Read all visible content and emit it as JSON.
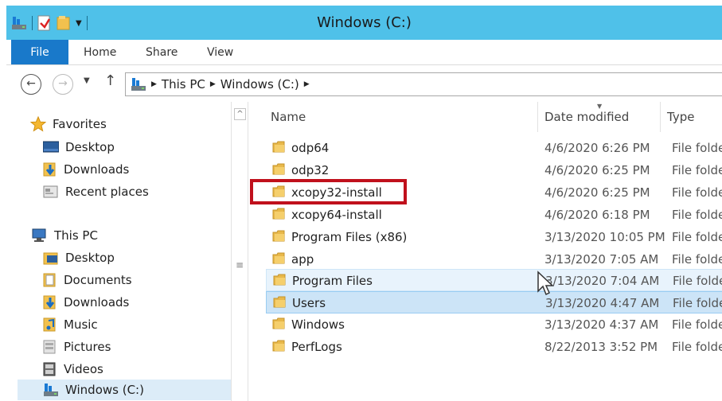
{
  "window": {
    "title": "Windows (C:)"
  },
  "ribbon": {
    "tabs": [
      "File",
      "Home",
      "Share",
      "View"
    ]
  },
  "address": {
    "crumbs": [
      "This PC",
      "Windows (C:)"
    ]
  },
  "nav": {
    "favorites_label": "Favorites",
    "favorites": [
      "Desktop",
      "Downloads",
      "Recent places"
    ],
    "thispc_label": "This PC",
    "thispc_items": [
      "Desktop",
      "Documents",
      "Downloads",
      "Music",
      "Pictures",
      "Videos",
      "Windows (C:)"
    ]
  },
  "columns": {
    "name": "Name",
    "date": "Date modified",
    "type": "Type"
  },
  "files": [
    {
      "name": "odp64",
      "date": "4/6/2020 6:26 PM",
      "type": "File folde"
    },
    {
      "name": "odp32",
      "date": "4/6/2020 6:25 PM",
      "type": "File folde"
    },
    {
      "name": "xcopy32-install",
      "date": "4/6/2020 6:25 PM",
      "type": "File folde"
    },
    {
      "name": "xcopy64-install",
      "date": "4/6/2020 6:18 PM",
      "type": "File folde"
    },
    {
      "name": "Program Files (x86)",
      "date": "3/13/2020 10:05 PM",
      "type": "File folde"
    },
    {
      "name": "app",
      "date": "3/13/2020 7:05 AM",
      "type": "File folde"
    },
    {
      "name": "Program Files",
      "date": "3/13/2020 7:04 AM",
      "type": "File folde"
    },
    {
      "name": "Users",
      "date": "3/13/2020 4:47 AM",
      "type": "File folde"
    },
    {
      "name": "Windows",
      "date": "3/13/2020 4:37 AM",
      "type": "File folde"
    },
    {
      "name": "PerfLogs",
      "date": "8/22/2013 3:52 PM",
      "type": "File folde"
    }
  ],
  "colors": {
    "titlebar": "#4fc1e9",
    "file_tab": "#1979ca",
    "highlight": "#c0101c",
    "folder": "#e8b84a"
  }
}
